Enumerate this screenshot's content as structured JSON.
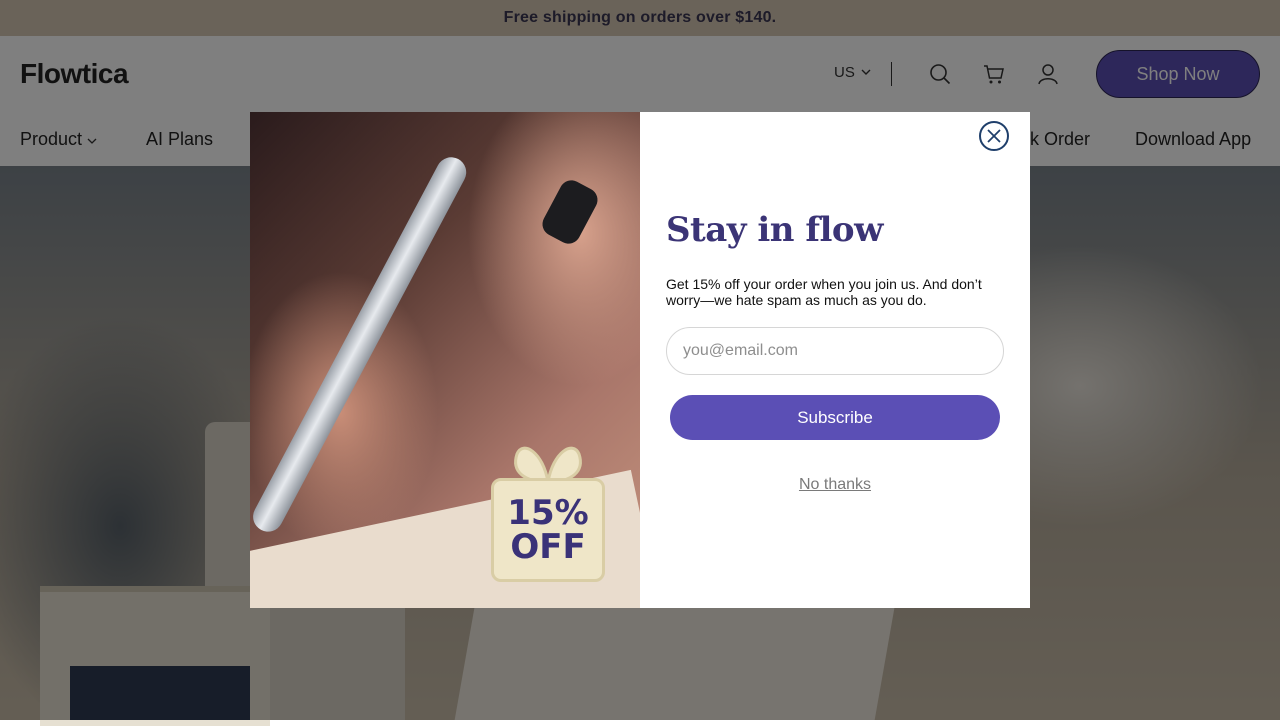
{
  "announcement": {
    "text": "Free shipping on orders over $140."
  },
  "header": {
    "logo": "Flowtica",
    "locale": "US",
    "shop_now": "Shop Now",
    "icons": [
      "chevron-down-icon",
      "search-icon",
      "cart-icon",
      "account-icon"
    ]
  },
  "nav": {
    "items": [
      {
        "label": "Product"
      },
      {
        "label": "AI Plans"
      },
      {
        "label": "k Order"
      },
      {
        "label": "Download App"
      }
    ]
  },
  "popup": {
    "badge_line1": "15%",
    "badge_line2": "OFF",
    "title": "Stay in flow",
    "description": "Get 15% off your order when you join us. And don’t worry—we hate spam as much as you do.",
    "email_placeholder": "you@email.com",
    "subscribe_label": "Subscribe",
    "no_thanks_label": "No thanks"
  },
  "colors": {
    "brand": "#5b4fb5",
    "title": "#3b3476",
    "announcement_bg": "#d4c6b3",
    "close_border": "#1f3f6b"
  }
}
